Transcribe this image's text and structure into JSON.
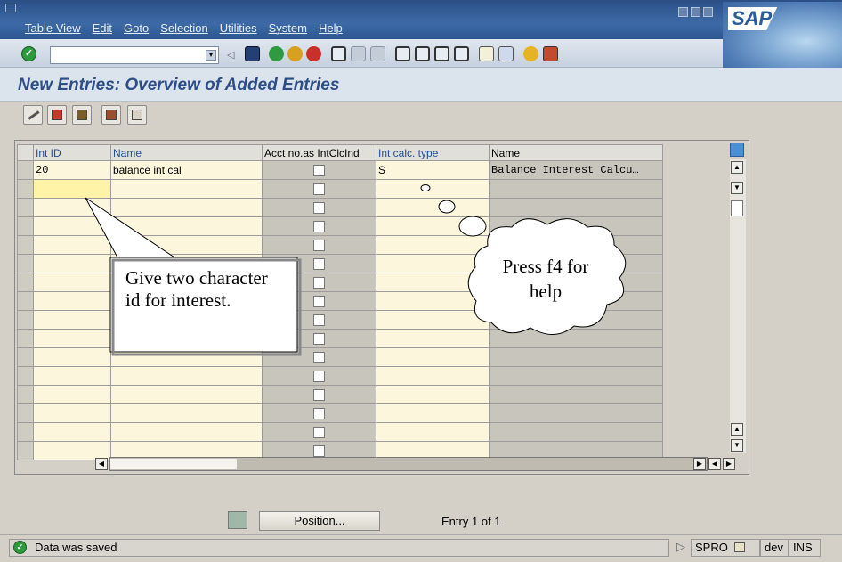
{
  "menu": {
    "items": [
      "Table View",
      "Edit",
      "Goto",
      "Selection",
      "Utilities",
      "System",
      "Help"
    ]
  },
  "logo": "SAP",
  "page_title": "New Entries: Overview of Added Entries",
  "table": {
    "headers": [
      "Int ID",
      "Name",
      "Acct no.as IntClcInd",
      "Int calc. type",
      "Name"
    ],
    "rows": [
      {
        "int_id": "20",
        "name": "balance int cal",
        "int_calc_type": "S",
        "type_name": "Balance Interest Calcu…"
      }
    ]
  },
  "position_button": "Position...",
  "entry_info": "Entry 1 of 1",
  "status": {
    "message": "Data was saved",
    "transaction": "SPRO",
    "system": "dev",
    "mode": "INS"
  },
  "callout_left": "Give two character id for interest.",
  "callout_right": "Press f4 for help",
  "colors": {
    "menubar": "#2f5a95",
    "title": "#2d4d86",
    "key_field": "#fbf6dc",
    "active_field": "#fff3a8"
  }
}
